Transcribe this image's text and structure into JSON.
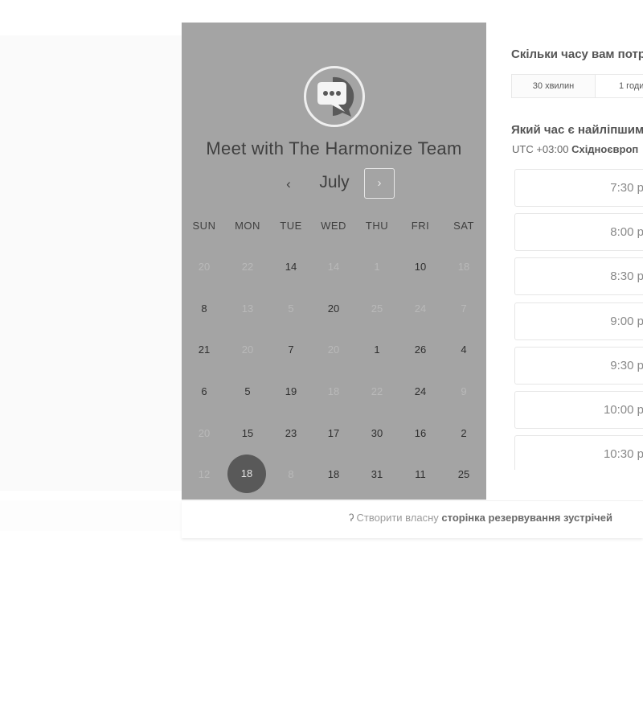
{
  "meeting_title": "Meet with The Harmonize Team",
  "avatar_icon": "chat-bubble-icon",
  "calendar": {
    "month": "July",
    "prev_glyph": "‹",
    "next_glyph": "›",
    "weekdays": [
      "SUN",
      "MON",
      "TUE",
      "WED",
      "THU",
      "FRI",
      "SAT"
    ],
    "weeks": [
      [
        [
          "20",
          "off"
        ],
        [
          "22",
          "off"
        ],
        [
          "14",
          "on"
        ],
        [
          "14",
          "off"
        ],
        [
          "1",
          "off"
        ],
        [
          "10",
          "on"
        ],
        [
          "18",
          "off"
        ]
      ],
      [
        [
          "8",
          "on"
        ],
        [
          "13",
          "off"
        ],
        [
          "5",
          "off"
        ],
        [
          "20",
          "on"
        ],
        [
          "25",
          "off"
        ],
        [
          "24",
          "off"
        ],
        [
          "7",
          "off"
        ]
      ],
      [
        [
          "21",
          "on"
        ],
        [
          "20",
          "off"
        ],
        [
          "7",
          "on"
        ],
        [
          "20",
          "off"
        ],
        [
          "1",
          "on"
        ],
        [
          "26",
          "on"
        ],
        [
          "4",
          "on"
        ]
      ],
      [
        [
          "6",
          "on"
        ],
        [
          "5",
          "on"
        ],
        [
          "19",
          "on"
        ],
        [
          "18",
          "off"
        ],
        [
          "22",
          "off"
        ],
        [
          "24",
          "on"
        ],
        [
          "9",
          "off"
        ]
      ],
      [
        [
          "20",
          "off"
        ],
        [
          "15",
          "on"
        ],
        [
          "23",
          "on"
        ],
        [
          "17",
          "on"
        ],
        [
          "30",
          "on"
        ],
        [
          "16",
          "on"
        ],
        [
          "2",
          "on"
        ]
      ],
      [
        [
          "12",
          "off"
        ],
        [
          "18",
          "selected"
        ],
        [
          "8",
          "off"
        ],
        [
          "18",
          "on"
        ],
        [
          "31",
          "on"
        ],
        [
          "11",
          "on"
        ],
        [
          "25",
          "on"
        ]
      ]
    ]
  },
  "duration": {
    "heading": "Скільки часу вам потр",
    "options": [
      "30 хвилин",
      "1 годи"
    ]
  },
  "time_picker": {
    "heading": "Який час є найліпшим",
    "timezone_prefix": "UTC +03:00",
    "timezone_name": "Східноєвроп",
    "slots": [
      "7:30 p",
      "8:00 p",
      "8:30 p",
      "9:00 p",
      "9:30 p",
      "10:00 p",
      "10:30 p"
    ]
  },
  "footer": {
    "icon": "hubspot-sprocket-icon",
    "text_plain": "Створити власну",
    "text_bold": "сторінка резервування зустрічей"
  },
  "colors": {
    "calendar_overlay": "#a4a4a4",
    "selected_day": "#595959"
  }
}
